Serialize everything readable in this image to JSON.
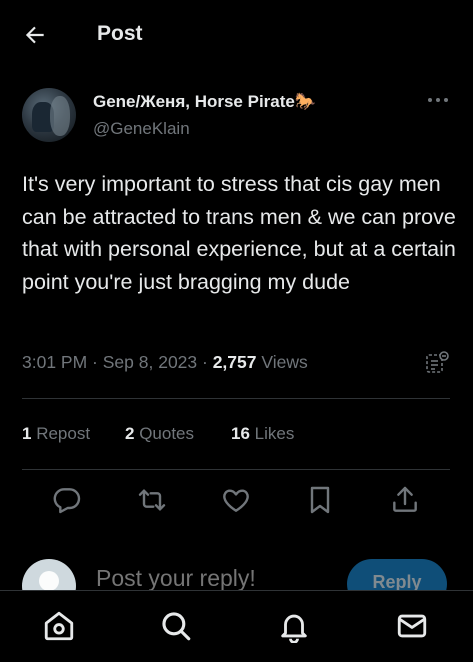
{
  "header": {
    "title": "Post",
    "back_icon": "arrow-left-icon"
  },
  "author": {
    "display_name": "Gene/Женя, Horse Pirate🐎",
    "handle": "@GeneKlain",
    "more_icon": "more-horizontal-icon"
  },
  "tweet": {
    "text": "It's very important to stress that cis gay men can be attracted to trans men & we can prove that with personal experience, but at a certain point you're just bragging my dude"
  },
  "meta": {
    "time": "3:01 PM",
    "sep1": " · ",
    "date": "Sep 8, 2023",
    "sep2": " · ",
    "views_count": "2,757",
    "views_label": " Views",
    "analytics_icon": "post-analytics-icon"
  },
  "stats": {
    "reposts_count": "1",
    "reposts_label": " Repost",
    "quotes_count": "2",
    "quotes_label": " Quotes",
    "likes_count": "16",
    "likes_label": " Likes"
  },
  "actions": [
    "reply-icon",
    "repost-icon",
    "like-icon",
    "bookmark-icon",
    "share-icon"
  ],
  "reply": {
    "placeholder": "Post your reply!",
    "button_label": "Reply"
  },
  "bottom_nav": [
    "home-icon",
    "search-icon",
    "notifications-icon",
    "messages-icon"
  ],
  "colors": {
    "background": "#000000",
    "text": "#e7e9ea",
    "muted": "#71767b",
    "accent": "#1d9bf0",
    "divider": "#2f3336"
  }
}
